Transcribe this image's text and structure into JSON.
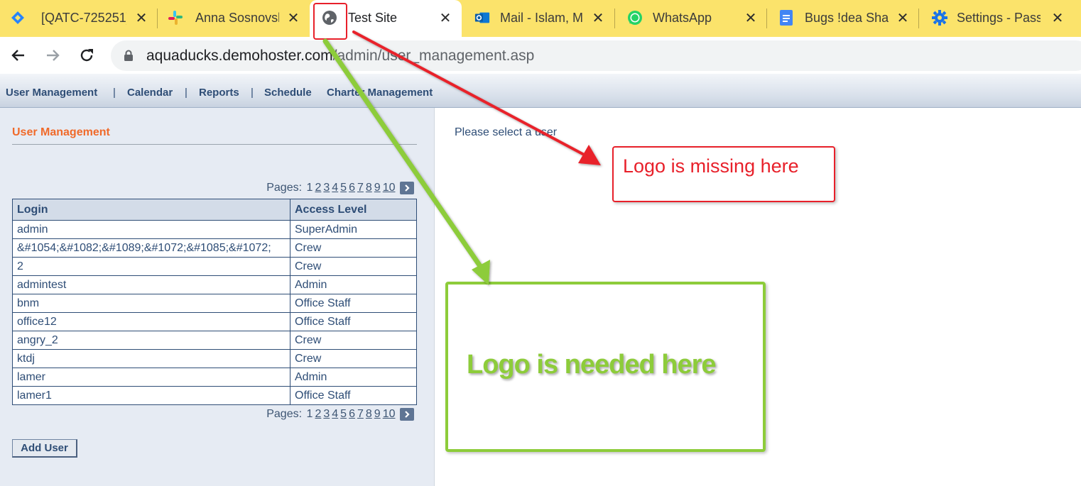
{
  "browser": {
    "tabs": [
      {
        "title": "[QATC-725251]",
        "icon": "jira-icon"
      },
      {
        "title": "Anna Sosnovsk",
        "icon": "slack-icon"
      },
      {
        "title": "Test Site",
        "icon": "globe-icon",
        "active": true
      },
      {
        "title": "Mail - Islam, M",
        "icon": "outlook-icon"
      },
      {
        "title": "WhatsApp",
        "icon": "whatsapp-icon"
      },
      {
        "title": "Bugs !dea Shar",
        "icon": "docs-icon"
      },
      {
        "title": "Settings - Pass",
        "icon": "gear-icon"
      }
    ],
    "url_host": "aquaducks.demohoster.com",
    "url_path": "/admin/user_management.asp"
  },
  "nav": {
    "items": [
      "User Management",
      "Calendar",
      "Reports",
      "Schedule",
      "Charter Management"
    ],
    "separator": "|"
  },
  "left": {
    "title": "User Management",
    "pager_label": "Pages:",
    "pages": [
      "1",
      "2",
      "3",
      "4",
      "5",
      "6",
      "7",
      "8",
      "9",
      "10"
    ],
    "columns": [
      "Login",
      "Access Level"
    ],
    "rows": [
      [
        "admin",
        "SuperAdmin"
      ],
      [
        "&#1054;&#1082;&#1089;&#1072;&#1085;&#1072;",
        "Crew"
      ],
      [
        "2",
        "Crew"
      ],
      [
        "admintest",
        "Admin"
      ],
      [
        "bnm",
        "Office Staff"
      ],
      [
        "office12",
        "Office Staff"
      ],
      [
        "angry_2",
        "Crew"
      ],
      [
        "ktdj",
        "Crew"
      ],
      [
        "lamer",
        "Admin"
      ],
      [
        "lamer1",
        "Office Staff"
      ]
    ],
    "add_user_label": "Add User"
  },
  "right": {
    "message": "Please select a user"
  },
  "annotations": {
    "red_note": "Logo is missing here",
    "green_note": "Logo is needed here",
    "red_color": "#e8202a",
    "green_color": "#8dcc3a"
  },
  "colors": {
    "tabstrip": "#fbe36b",
    "link": "#2e4d76",
    "section_title": "#f06a2a"
  }
}
